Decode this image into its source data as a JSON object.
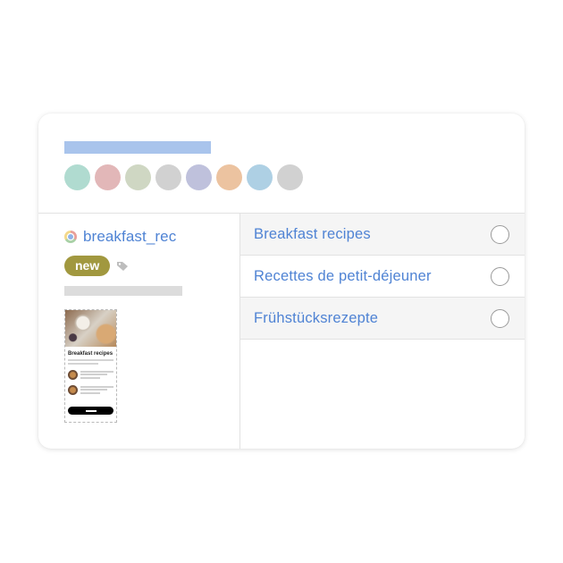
{
  "header": {
    "swatches": [
      {
        "name": "teal",
        "color": "#b0dbd0"
      },
      {
        "name": "rose",
        "color": "#e2b7b8"
      },
      {
        "name": "sage",
        "color": "#cfd7c3"
      },
      {
        "name": "grey",
        "color": "#d1d1d1"
      },
      {
        "name": "lavender",
        "color": "#bfc1dc"
      },
      {
        "name": "apricot",
        "color": "#ecc3a0"
      },
      {
        "name": "sky",
        "color": "#aed0e4"
      },
      {
        "name": "grey2",
        "color": "#d1d1d1"
      }
    ]
  },
  "tab": {
    "icon": "chrome-icon",
    "name": "breakfast_rec",
    "badge": "new",
    "tag_icon": "tag-icon"
  },
  "thumbnail": {
    "title": "Breakfast recipes"
  },
  "options": [
    {
      "label": "Breakfast recipes",
      "selected": false
    },
    {
      "label": "Recettes de petit-déjeuner",
      "selected": false
    },
    {
      "label": "Frühstücksrezepte",
      "selected": false
    }
  ],
  "colors": {
    "accent": "#4f83d4",
    "badge": "#a1983f",
    "title_bar": "#a9c4ec"
  }
}
